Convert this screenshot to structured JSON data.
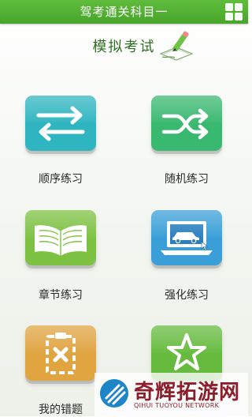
{
  "header": {
    "title": "驾考通关科目一"
  },
  "section": {
    "title": "模拟考试"
  },
  "tiles": [
    {
      "label": "顺序练习",
      "icon": "sequential-arrows-icon",
      "color": "#2fb5c0"
    },
    {
      "label": "随机练习",
      "icon": "shuffle-icon",
      "color": "#39b86f"
    },
    {
      "label": "章节练习",
      "icon": "open-book-icon",
      "color": "#7dc142"
    },
    {
      "label": "强化练习",
      "icon": "laptop-car-icon",
      "color": "#3a9fd8"
    },
    {
      "label": "我的错题",
      "icon": "clipboard-x-icon",
      "color": "#e0a441"
    },
    {
      "label": "",
      "icon": "star-icon",
      "color": "#66bb3f"
    }
  ],
  "watermark": {
    "name": "奇辉拓游网",
    "sub": "QIHUI TUOYOU NETWORK"
  }
}
